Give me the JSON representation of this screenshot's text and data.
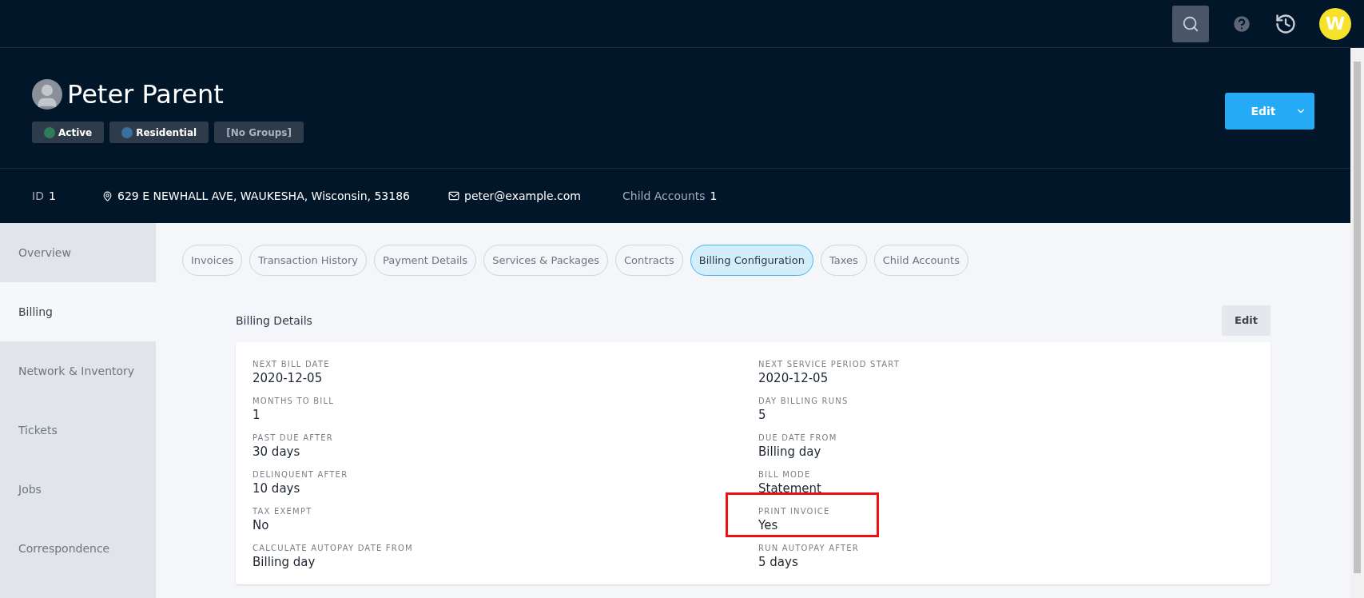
{
  "top_bar": {
    "avatar_letter": "W"
  },
  "header": {
    "name": "Peter Parent",
    "badges": [
      {
        "label": "Active",
        "color": "#2e7d5b"
      },
      {
        "label": "Residential",
        "color": "#3a6fa0"
      },
      {
        "label": "[No Groups]"
      }
    ],
    "edit_button": "Edit"
  },
  "info": [
    {
      "kind": "pair",
      "label": "ID",
      "value": "1"
    },
    {
      "kind": "address",
      "value": "629 E NEWHALL AVE, WAUKESHA, Wisconsin, 53186"
    },
    {
      "kind": "email",
      "value": "peter@example.com"
    },
    {
      "kind": "pair",
      "label": "Child Accounts",
      "value": "1"
    }
  ],
  "sidebar": {
    "items": [
      {
        "label": "Overview",
        "selected": false
      },
      {
        "label": "Billing",
        "selected": true
      },
      {
        "label": "Network & Inventory",
        "selected": false
      },
      {
        "label": "Tickets",
        "selected": false
      },
      {
        "label": "Jobs",
        "selected": false
      },
      {
        "label": "Correspondence",
        "selected": false
      }
    ]
  },
  "tabs": [
    {
      "label": "Invoices",
      "selected": false
    },
    {
      "label": "Transaction History",
      "selected": false
    },
    {
      "label": "Payment Details",
      "selected": false
    },
    {
      "label": "Services & Packages",
      "selected": false
    },
    {
      "label": "Contracts",
      "selected": false
    },
    {
      "label": "Billing Configuration",
      "selected": true
    },
    {
      "label": "Taxes",
      "selected": false
    },
    {
      "label": "Child Accounts",
      "selected": false
    }
  ],
  "billing_details": {
    "title": "Billing Details",
    "edit_button": "Edit",
    "left": [
      {
        "label": "NEXT BILL DATE",
        "value": "2020-12-05",
        "highlighted": false
      },
      {
        "label": "MONTHS TO BILL",
        "value": "1",
        "highlighted": false
      },
      {
        "label": "PAST DUE AFTER",
        "value": "30 days",
        "highlighted": false
      },
      {
        "label": "DELINQUENT AFTER",
        "value": "10 days",
        "highlighted": false
      },
      {
        "label": "TAX EXEMPT",
        "value": "No",
        "highlighted": false
      },
      {
        "label": "CALCULATE AUTOPAY DATE FROM",
        "value": "Billing day",
        "highlighted": false
      }
    ],
    "right": [
      {
        "label": "NEXT SERVICE PERIOD START",
        "value": "2020-12-05",
        "highlighted": false
      },
      {
        "label": "DAY BILLING RUNS",
        "value": "5",
        "highlighted": false
      },
      {
        "label": "DUE DATE FROM",
        "value": "Billing day",
        "highlighted": false
      },
      {
        "label": "BILL MODE",
        "value": "Statement",
        "highlighted": false
      },
      {
        "label": "PRINT INVOICE",
        "value": "Yes",
        "highlighted": true
      },
      {
        "label": "RUN AUTOPAY AFTER",
        "value": "5 days",
        "highlighted": false
      }
    ]
  }
}
